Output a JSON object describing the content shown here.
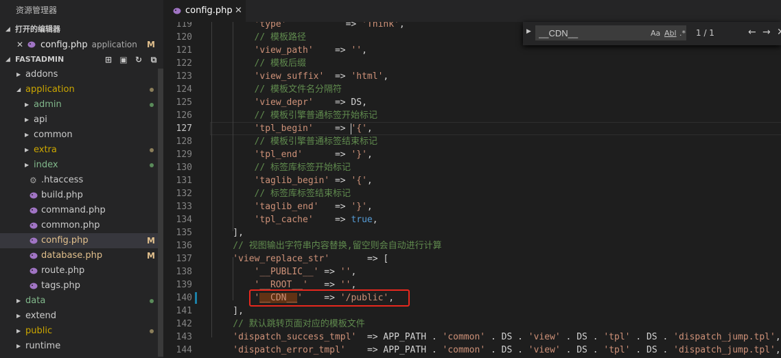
{
  "sidebar": {
    "title": "资源管理器",
    "open_editors_label": "打开的编辑器",
    "open_editor": {
      "close": "✕",
      "name": "config.php",
      "desc": "application",
      "badge": "M"
    },
    "project_label": "FASTADMIN",
    "actions": [
      "new-file-icon",
      "new-folder-icon",
      "refresh-icon",
      "collapse-all-icon"
    ],
    "tree": [
      {
        "label": "addons",
        "type": "folder",
        "depth": 0
      },
      {
        "label": "application",
        "type": "folder",
        "depth": 0,
        "expanded": true,
        "dot": "#8b7e5a"
      },
      {
        "label": "admin",
        "type": "folder",
        "depth": 1,
        "dot": "#5a8b5a"
      },
      {
        "label": "api",
        "type": "folder",
        "depth": 1
      },
      {
        "label": "common",
        "type": "folder",
        "depth": 1
      },
      {
        "label": "extra",
        "type": "folder",
        "depth": 1,
        "dot": "#8b7e5a"
      },
      {
        "label": "index",
        "type": "folder",
        "depth": 1,
        "dot": "#5a8b5a"
      },
      {
        "label": ".htaccess",
        "type": "gear",
        "depth": 1
      },
      {
        "label": "build.php",
        "type": "php",
        "depth": 1
      },
      {
        "label": "command.php",
        "type": "php",
        "depth": 1
      },
      {
        "label": "common.php",
        "type": "php",
        "depth": 1
      },
      {
        "label": "config.php",
        "type": "php",
        "depth": 1,
        "badge": "M",
        "selected": true
      },
      {
        "label": "database.php",
        "type": "php",
        "depth": 1,
        "badge": "M"
      },
      {
        "label": "route.php",
        "type": "php",
        "depth": 1
      },
      {
        "label": "tags.php",
        "type": "php",
        "depth": 1
      },
      {
        "label": "data",
        "type": "folder",
        "depth": 0,
        "dot": "#5a8b5a"
      },
      {
        "label": "extend",
        "type": "folder",
        "depth": 0
      },
      {
        "label": "public",
        "type": "folder",
        "depth": 0,
        "dot": "#8b7e5a"
      },
      {
        "label": "runtime",
        "type": "folder",
        "depth": 0
      }
    ]
  },
  "tab": {
    "name": "config.php",
    "close": "✕"
  },
  "find": {
    "value": "__CDN__",
    "match_case": "Aa",
    "whole_word": "Abl",
    "regex": ".*",
    "count": "1 / 1",
    "prev": "←",
    "next": "→",
    "close": "✕"
  },
  "code": {
    "current_line": "127",
    "lines": [
      {
        "n": "119",
        "indent": 8,
        "t": [
          [
            "str",
            "'type'"
          ],
          [
            "plain",
            "           => "
          ],
          [
            "str",
            "'Think'"
          ],
          [
            "plain",
            ","
          ]
        ]
      },
      {
        "n": "120",
        "indent": 8,
        "t": [
          [
            "cmt",
            "// 模板路径"
          ]
        ]
      },
      {
        "n": "121",
        "indent": 8,
        "t": [
          [
            "str",
            "'view_path'"
          ],
          [
            "plain",
            "    => "
          ],
          [
            "str",
            "''"
          ],
          [
            "plain",
            ","
          ]
        ]
      },
      {
        "n": "122",
        "indent": 8,
        "t": [
          [
            "cmt",
            "// 模板后缀"
          ]
        ]
      },
      {
        "n": "123",
        "indent": 8,
        "t": [
          [
            "str",
            "'view_suffix'"
          ],
          [
            "plain",
            "  => "
          ],
          [
            "str",
            "'html'"
          ],
          [
            "plain",
            ","
          ]
        ]
      },
      {
        "n": "124",
        "indent": 8,
        "t": [
          [
            "cmt",
            "// 模板文件名分隔符"
          ]
        ]
      },
      {
        "n": "125",
        "indent": 8,
        "t": [
          [
            "str",
            "'view_depr'"
          ],
          [
            "plain",
            "    => DS,"
          ]
        ]
      },
      {
        "n": "126",
        "indent": 8,
        "t": [
          [
            "cmt",
            "// 模板引擎普通标签开始标记"
          ]
        ]
      },
      {
        "n": "127",
        "indent": 8,
        "t": [
          [
            "str",
            "'tpl_begin'"
          ],
          [
            "plain",
            "    => "
          ],
          [
            "str",
            "'{'"
          ],
          [
            "plain",
            ","
          ]
        ]
      },
      {
        "n": "128",
        "indent": 8,
        "t": [
          [
            "cmt",
            "// 模板引擎普通标签结束标记"
          ]
        ]
      },
      {
        "n": "129",
        "indent": 8,
        "t": [
          [
            "str",
            "'tpl_end'"
          ],
          [
            "plain",
            "      => "
          ],
          [
            "str",
            "'}'"
          ],
          [
            "plain",
            ","
          ]
        ]
      },
      {
        "n": "130",
        "indent": 8,
        "t": [
          [
            "cmt",
            "// 标签库标签开始标记"
          ]
        ]
      },
      {
        "n": "131",
        "indent": 8,
        "t": [
          [
            "str",
            "'taglib_begin'"
          ],
          [
            "plain",
            " => "
          ],
          [
            "str",
            "'{'"
          ],
          [
            "plain",
            ","
          ]
        ]
      },
      {
        "n": "132",
        "indent": 8,
        "t": [
          [
            "cmt",
            "// 标签库标签结束标记"
          ]
        ]
      },
      {
        "n": "133",
        "indent": 8,
        "t": [
          [
            "str",
            "'taglib_end'"
          ],
          [
            "plain",
            "   => "
          ],
          [
            "str",
            "'}'"
          ],
          [
            "plain",
            ","
          ]
        ]
      },
      {
        "n": "134",
        "indent": 8,
        "t": [
          [
            "str",
            "'tpl_cache'"
          ],
          [
            "plain",
            "    => "
          ],
          [
            "kw",
            "true"
          ],
          [
            "plain",
            ","
          ]
        ]
      },
      {
        "n": "135",
        "indent": 4,
        "t": [
          [
            "plain",
            "],"
          ]
        ]
      },
      {
        "n": "136",
        "indent": 4,
        "t": [
          [
            "cmt",
            "// 视图输出字符串内容替换,留空则会自动进行计算"
          ]
        ]
      },
      {
        "n": "137",
        "indent": 4,
        "t": [
          [
            "str",
            "'view_replace_str'"
          ],
          [
            "plain",
            "       => ["
          ]
        ]
      },
      {
        "n": "138",
        "indent": 8,
        "t": [
          [
            "str",
            "'__PUBLIC__'"
          ],
          [
            "plain",
            " => "
          ],
          [
            "str",
            "''"
          ],
          [
            "plain",
            ","
          ]
        ]
      },
      {
        "n": "139",
        "indent": 8,
        "t": [
          [
            "str",
            "'__ROOT__'"
          ],
          [
            "plain",
            "   => "
          ],
          [
            "str",
            "''"
          ],
          [
            "plain",
            ","
          ]
        ]
      },
      {
        "n": "140",
        "indent": 8,
        "t": [
          [
            "str",
            "'"
          ],
          [
            "hl",
            "__CDN__"
          ],
          [
            "str",
            "'"
          ],
          [
            "plain",
            "    => "
          ],
          [
            "str",
            "'/public'"
          ],
          [
            "plain",
            ","
          ]
        ]
      },
      {
        "n": "141",
        "indent": 4,
        "t": [
          [
            "plain",
            "],"
          ]
        ]
      },
      {
        "n": "142",
        "indent": 4,
        "t": [
          [
            "cmt",
            "// 默认跳转页面对应的模板文件"
          ]
        ]
      },
      {
        "n": "143",
        "indent": 4,
        "t": [
          [
            "str",
            "'dispatch_success_tmpl'"
          ],
          [
            "plain",
            "  => APP_PATH . "
          ],
          [
            "str",
            "'common'"
          ],
          [
            "plain",
            " . DS . "
          ],
          [
            "str",
            "'view'"
          ],
          [
            "plain",
            " . DS . "
          ],
          [
            "str",
            "'tpl'"
          ],
          [
            "plain",
            " . DS . "
          ],
          [
            "str",
            "'dispatch_jump.tpl'"
          ],
          [
            "plain",
            ","
          ]
        ]
      },
      {
        "n": "144",
        "indent": 4,
        "t": [
          [
            "str",
            "'dispatch_error_tmpl'"
          ],
          [
            "plain",
            "    => APP_PATH . "
          ],
          [
            "str",
            "'common'"
          ],
          [
            "plain",
            " . DS . "
          ],
          [
            "str",
            "'view'"
          ],
          [
            "plain",
            " . DS . "
          ],
          [
            "str",
            "'tpl'"
          ],
          [
            "plain",
            " . DS . "
          ],
          [
            "str",
            "'dispatch_jump.tpl'"
          ],
          [
            "plain",
            ","
          ]
        ]
      }
    ]
  }
}
